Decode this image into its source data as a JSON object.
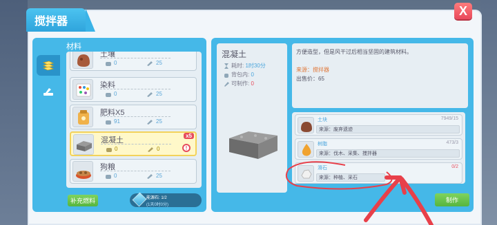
{
  "window": {
    "title": "搅拌器",
    "close_glyph": "X"
  },
  "left_panel": {
    "label": "材料",
    "category_tabs": [
      {
        "name": "materials-category-icon",
        "active": true
      },
      {
        "name": "tools-category-icon",
        "active": false
      }
    ],
    "items": [
      {
        "name": "土壤",
        "stock": "0",
        "craftable": "25",
        "icon": "soil-icon",
        "selected": false
      },
      {
        "name": "染料",
        "stock": "0",
        "craftable": "25",
        "icon": "palette-icon",
        "selected": false
      },
      {
        "name": "肥料X5",
        "stock": "91",
        "craftable": "25",
        "icon": "fertilizer-icon",
        "selected": false
      },
      {
        "name": "混凝土",
        "stock": "0",
        "craftable": "0",
        "icon": "concrete-icon",
        "selected": true,
        "badge": "x5",
        "warning": "!"
      },
      {
        "name": "狗粮",
        "stock": "0",
        "craftable": "25",
        "icon": "dogfood-icon",
        "selected": false
      }
    ],
    "fuel_button": "补充燃料",
    "fuel": {
      "line1": "能源石: 1/2",
      "line2": "(1天0时0分)"
    }
  },
  "detail": {
    "title": "混凝土",
    "time_label": "耗时:",
    "time_value": "1时30分",
    "bag_label": "背包内:",
    "bag_value": "0",
    "craft_label": "可制作:",
    "craft_value": "0",
    "description": "方便造型，但是风干过后相当坚固的建筑材料。",
    "source": "来源：搅拌器",
    "price": "出售价：65"
  },
  "requirements": [
    {
      "name": "土块",
      "count": "7949/15",
      "source": "来源：废弃遗迹",
      "icon": "dirt-block-icon",
      "short": false
    },
    {
      "name": "树脂",
      "count": "473/3",
      "source": "来源：伐木、采集、搅拌器",
      "icon": "resin-icon",
      "short": false
    },
    {
      "name": "滑石",
      "count": "0/2",
      "source": "来源：种植、采石",
      "icon": "talc-icon",
      "short": true
    }
  ],
  "craft_button": "制作",
  "colors": {
    "panel_blue": "#45b8e8",
    "accent_green": "#56b53e",
    "alert_red": "#e74c5c",
    "annotation_red": "#e8404a"
  }
}
